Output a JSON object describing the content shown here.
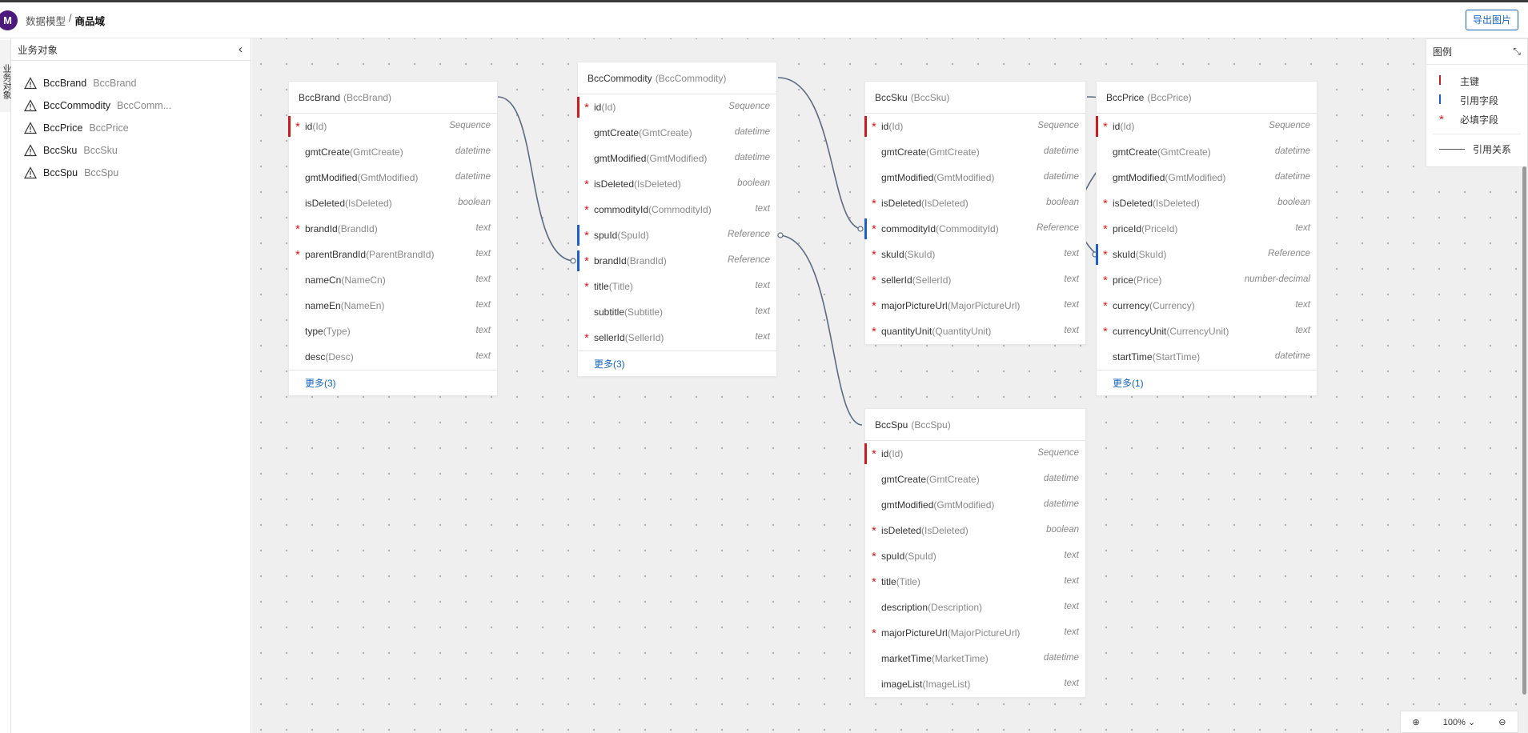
{
  "header": {
    "logo_letter": "M",
    "breadcrumb_parent": "数据模型",
    "breadcrumb_sep": "/",
    "breadcrumb_current": "商品域",
    "export_label": "导出图片"
  },
  "rail": {
    "tab_label": "业务对象"
  },
  "panel": {
    "title": "业务对象",
    "items": [
      {
        "name": "BccBrand",
        "code": "BccBrand"
      },
      {
        "name": "BccCommodity",
        "code": "BccComm..."
      },
      {
        "name": "BccPrice",
        "code": "BccPrice"
      },
      {
        "name": "BccSku",
        "code": "BccSku"
      },
      {
        "name": "BccSpu",
        "code": "BccSpu"
      }
    ]
  },
  "entities": {
    "brand": {
      "name": "BccBrand",
      "code": "(BccBrand)",
      "fields": [
        {
          "name": "id",
          "code": "(Id)",
          "type": "Sequence",
          "req": true,
          "kind": "pk"
        },
        {
          "name": "gmtCreate",
          "code": "(GmtCreate)",
          "type": "datetime",
          "req": false,
          "kind": ""
        },
        {
          "name": "gmtModified",
          "code": "(GmtModified)",
          "type": "datetime",
          "req": false,
          "kind": ""
        },
        {
          "name": "isDeleted",
          "code": "(IsDeleted)",
          "type": "boolean",
          "req": false,
          "kind": ""
        },
        {
          "name": "brandId",
          "code": "(BrandId)",
          "type": "text",
          "req": true,
          "kind": ""
        },
        {
          "name": "parentBrandId",
          "code": "(ParentBrandId)",
          "type": "text",
          "req": true,
          "kind": ""
        },
        {
          "name": "nameCn",
          "code": "(NameCn)",
          "type": "text",
          "req": false,
          "kind": ""
        },
        {
          "name": "nameEn",
          "code": "(NameEn)",
          "type": "text",
          "req": false,
          "kind": ""
        },
        {
          "name": "type",
          "code": "(Type)",
          "type": "text",
          "req": false,
          "kind": ""
        },
        {
          "name": "desc",
          "code": "(Desc)",
          "type": "text",
          "req": false,
          "kind": ""
        }
      ],
      "more": "更多(3)"
    },
    "commodity": {
      "name": "BccCommodity",
      "code": "(BccCommodity)",
      "fields": [
        {
          "name": "id",
          "code": "(Id)",
          "type": "Sequence",
          "req": true,
          "kind": "pk"
        },
        {
          "name": "gmtCreate",
          "code": "(GmtCreate)",
          "type": "datetime",
          "req": false,
          "kind": ""
        },
        {
          "name": "gmtModified",
          "code": "(GmtModified)",
          "type": "datetime",
          "req": false,
          "kind": ""
        },
        {
          "name": "isDeleted",
          "code": "(IsDeleted)",
          "type": "boolean",
          "req": true,
          "kind": ""
        },
        {
          "name": "commodityId",
          "code": "(CommodityId)",
          "type": "text",
          "req": true,
          "kind": ""
        },
        {
          "name": "spuId",
          "code": "(SpuId)",
          "type": "Reference",
          "req": true,
          "kind": "ref"
        },
        {
          "name": "brandId",
          "code": "(BrandId)",
          "type": "Reference",
          "req": true,
          "kind": "ref"
        },
        {
          "name": "title",
          "code": "(Title)",
          "type": "text",
          "req": true,
          "kind": ""
        },
        {
          "name": "subtitle",
          "code": "(Subtitle)",
          "type": "text",
          "req": false,
          "kind": ""
        },
        {
          "name": "sellerId",
          "code": "(SellerId)",
          "type": "text",
          "req": true,
          "kind": ""
        }
      ],
      "more": "更多(3)"
    },
    "sku": {
      "name": "BccSku",
      "code": "(BccSku)",
      "fields": [
        {
          "name": "id",
          "code": "(Id)",
          "type": "Sequence",
          "req": true,
          "kind": "pk"
        },
        {
          "name": "gmtCreate",
          "code": "(GmtCreate)",
          "type": "datetime",
          "req": false,
          "kind": ""
        },
        {
          "name": "gmtModified",
          "code": "(GmtModified)",
          "type": "datetime",
          "req": false,
          "kind": ""
        },
        {
          "name": "isDeleted",
          "code": "(IsDeleted)",
          "type": "boolean",
          "req": true,
          "kind": ""
        },
        {
          "name": "commodityId",
          "code": "(CommodityId)",
          "type": "Reference",
          "req": true,
          "kind": "ref"
        },
        {
          "name": "skuId",
          "code": "(SkuId)",
          "type": "text",
          "req": true,
          "kind": ""
        },
        {
          "name": "sellerId",
          "code": "(SellerId)",
          "type": "text",
          "req": true,
          "kind": ""
        },
        {
          "name": "majorPictureUrl",
          "code": "(MajorPictureUrl)",
          "type": "text",
          "req": true,
          "kind": ""
        },
        {
          "name": "quantityUnit",
          "code": "(QuantityUnit)",
          "type": "text",
          "req": true,
          "kind": ""
        }
      ],
      "more": ""
    },
    "price": {
      "name": "BccPrice",
      "code": "(BccPrice)",
      "fields": [
        {
          "name": "id",
          "code": "(Id)",
          "type": "Sequence",
          "req": true,
          "kind": "pk"
        },
        {
          "name": "gmtCreate",
          "code": "(GmtCreate)",
          "type": "datetime",
          "req": false,
          "kind": ""
        },
        {
          "name": "gmtModified",
          "code": "(GmtModified)",
          "type": "datetime",
          "req": false,
          "kind": ""
        },
        {
          "name": "isDeleted",
          "code": "(IsDeleted)",
          "type": "boolean",
          "req": true,
          "kind": ""
        },
        {
          "name": "priceId",
          "code": "(PriceId)",
          "type": "text",
          "req": true,
          "kind": ""
        },
        {
          "name": "skuId",
          "code": "(SkuId)",
          "type": "Reference",
          "req": true,
          "kind": "ref"
        },
        {
          "name": "price",
          "code": "(Price)",
          "type": "number-decimal",
          "req": true,
          "kind": ""
        },
        {
          "name": "currency",
          "code": "(Currency)",
          "type": "text",
          "req": true,
          "kind": ""
        },
        {
          "name": "currencyUnit",
          "code": "(CurrencyUnit)",
          "type": "text",
          "req": true,
          "kind": ""
        },
        {
          "name": "startTime",
          "code": "(StartTime)",
          "type": "datetime",
          "req": false,
          "kind": ""
        }
      ],
      "more": "更多(1)"
    },
    "spu": {
      "name": "BccSpu",
      "code": "(BccSpu)",
      "fields": [
        {
          "name": "id",
          "code": "(Id)",
          "type": "Sequence",
          "req": true,
          "kind": "pk"
        },
        {
          "name": "gmtCreate",
          "code": "(GmtCreate)",
          "type": "datetime",
          "req": false,
          "kind": ""
        },
        {
          "name": "gmtModified",
          "code": "(GmtModified)",
          "type": "datetime",
          "req": false,
          "kind": ""
        },
        {
          "name": "isDeleted",
          "code": "(IsDeleted)",
          "type": "boolean",
          "req": true,
          "kind": ""
        },
        {
          "name": "spuId",
          "code": "(SpuId)",
          "type": "text",
          "req": true,
          "kind": ""
        },
        {
          "name": "title",
          "code": "(Title)",
          "type": "text",
          "req": true,
          "kind": ""
        },
        {
          "name": "description",
          "code": "(Description)",
          "type": "text",
          "req": false,
          "kind": ""
        },
        {
          "name": "majorPictureUrl",
          "code": "(MajorPictureUrl)",
          "type": "text",
          "req": true,
          "kind": ""
        },
        {
          "name": "marketTime",
          "code": "(MarketTime)",
          "type": "datetime",
          "req": false,
          "kind": ""
        },
        {
          "name": "imageList",
          "code": "(ImageList)",
          "type": "text",
          "req": false,
          "kind": ""
        }
      ],
      "more": ""
    }
  },
  "legend": {
    "title": "图例",
    "primary_key": "主键",
    "reference_field": "引用字段",
    "required_field": "必填字段",
    "reference_relation": "引用关系"
  },
  "zoom": {
    "level": "100%"
  },
  "colors": {
    "pk": "#c81e1e",
    "ref": "#1e5fc8",
    "required": "#d21c1c",
    "link": "#5a6a80",
    "accent": "#1565c0"
  }
}
